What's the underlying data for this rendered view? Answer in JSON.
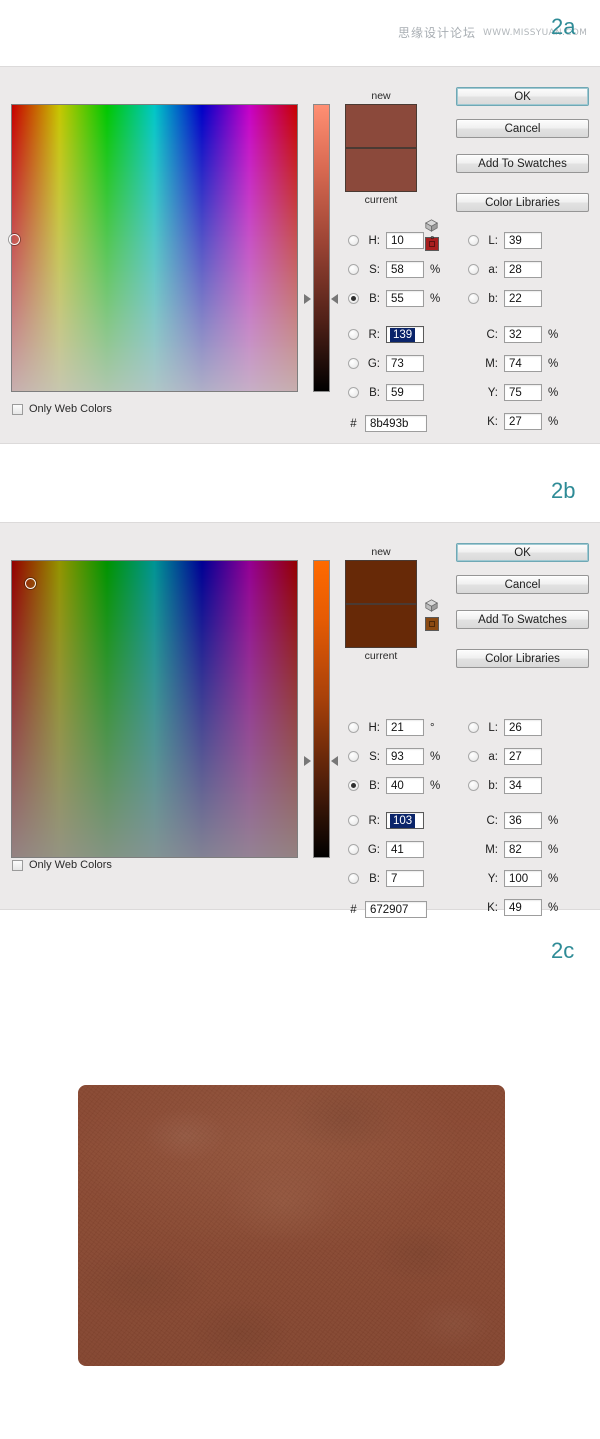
{
  "watermark": {
    "cn_text": "思缘设计论坛",
    "en_text": "WWW.MISSYUAN.COM"
  },
  "steps": [
    {
      "id": "2a",
      "label": "2a"
    },
    {
      "id": "2b",
      "label": "2b"
    },
    {
      "id": "2c",
      "label": "2c"
    }
  ],
  "accent_color": "#2e8b96",
  "dialogs": [
    {
      "id": "color-picker-2a",
      "picker": {
        "mode_axis": "brightness",
        "brightness_percent": 55,
        "marker_x_percent": 1,
        "marker_y_percent": 47,
        "slider_top_color": "#ff8f73",
        "slider_bottom_color": "#000000",
        "slider_handle_percent": 45
      },
      "only_web_colors": {
        "label": "Only Web Colors",
        "checked": false
      },
      "preview": {
        "new_label": "new",
        "current_label": "current",
        "new_color": "#8b493b",
        "current_color": "#8b493b",
        "gamut_icon": "out-of-gamut-warning-icon",
        "websafe_color": "#a81f1f"
      },
      "buttons": [
        {
          "name": "ok-button",
          "label": "OK",
          "primary": true
        },
        {
          "name": "cancel-button",
          "label": "Cancel",
          "primary": false
        },
        {
          "name": "add-to-swatches-button",
          "label": "Add To Swatches",
          "primary": false
        },
        {
          "name": "color-libraries-button",
          "label": "Color Libraries",
          "primary": false
        }
      ],
      "hsb": [
        {
          "key": "H",
          "label": "H:",
          "value": "10",
          "unit": "°",
          "selected_radio": false
        },
        {
          "key": "S",
          "label": "S:",
          "value": "58",
          "unit": "%",
          "selected_radio": false
        },
        {
          "key": "B",
          "label": "B:",
          "value": "55",
          "unit": "%",
          "selected_radio": true
        }
      ],
      "rgb": [
        {
          "key": "R",
          "label": "R:",
          "value": "139",
          "unit": "",
          "selected_radio": false,
          "text_selected": true
        },
        {
          "key": "G",
          "label": "G:",
          "value": "73",
          "unit": "",
          "selected_radio": false,
          "text_selected": false
        },
        {
          "key": "B",
          "label": "B:",
          "value": "59",
          "unit": "",
          "selected_radio": false,
          "text_selected": false
        }
      ],
      "hex": {
        "prefix": "#",
        "value": "8b493b"
      },
      "lab": [
        {
          "key": "L",
          "label": "L:",
          "value": "39",
          "unit": ""
        },
        {
          "key": "a",
          "label": "a:",
          "value": "28",
          "unit": ""
        },
        {
          "key": "b",
          "label": "b:",
          "value": "22",
          "unit": ""
        }
      ],
      "cmyk": [
        {
          "key": "C",
          "label": "C:",
          "value": "32",
          "unit": "%"
        },
        {
          "key": "M",
          "label": "M:",
          "value": "74",
          "unit": "%"
        },
        {
          "key": "Y",
          "label": "Y:",
          "value": "75",
          "unit": "%"
        },
        {
          "key": "K",
          "label": "K:",
          "value": "27",
          "unit": "%"
        }
      ]
    },
    {
      "id": "color-picker-2b",
      "picker": {
        "mode_axis": "brightness",
        "brightness_percent": 40,
        "marker_x_percent": 4,
        "marker_y_percent": 7,
        "slider_top_color": "#ff6a00",
        "slider_bottom_color": "#000000",
        "slider_handle_percent": 45,
        "field_brightness_overlay": 0.38
      },
      "only_web_colors": {
        "label": "Only Web Colors",
        "checked": false
      },
      "preview": {
        "new_label": "new",
        "current_label": "current",
        "new_color": "#672907",
        "current_color": "#672907",
        "gamut_icon": "out-of-gamut-warning-icon",
        "websafe_color": "#8a4a12"
      },
      "buttons": [
        {
          "name": "ok-button",
          "label": "OK",
          "primary": true
        },
        {
          "name": "cancel-button",
          "label": "Cancel",
          "primary": false
        },
        {
          "name": "add-to-swatches-button",
          "label": "Add To Swatches",
          "primary": false
        },
        {
          "name": "color-libraries-button",
          "label": "Color Libraries",
          "primary": false
        }
      ],
      "hsb": [
        {
          "key": "H",
          "label": "H:",
          "value": "21",
          "unit": "°",
          "selected_radio": false
        },
        {
          "key": "S",
          "label": "S:",
          "value": "93",
          "unit": "%",
          "selected_radio": false
        },
        {
          "key": "B",
          "label": "B:",
          "value": "40",
          "unit": "%",
          "selected_radio": true
        }
      ],
      "rgb": [
        {
          "key": "R",
          "label": "R:",
          "value": "103",
          "unit": "",
          "selected_radio": false,
          "text_selected": true
        },
        {
          "key": "G",
          "label": "G:",
          "value": "41",
          "unit": "",
          "selected_radio": false,
          "text_selected": false
        },
        {
          "key": "B",
          "label": "B:",
          "value": "7",
          "unit": "",
          "selected_radio": false,
          "text_selected": false
        }
      ],
      "hex": {
        "prefix": "#",
        "value": "672907"
      },
      "lab": [
        {
          "key": "L",
          "label": "L:",
          "value": "26",
          "unit": ""
        },
        {
          "key": "a",
          "label": "a:",
          "value": "27",
          "unit": ""
        },
        {
          "key": "b",
          "label": "b:",
          "value": "34",
          "unit": ""
        }
      ],
      "cmyk": [
        {
          "key": "C",
          "label": "C:",
          "value": "36",
          "unit": "%"
        },
        {
          "key": "M",
          "label": "M:",
          "value": "82",
          "unit": "%"
        },
        {
          "key": "Y",
          "label": "Y:",
          "value": "100",
          "unit": "%"
        },
        {
          "key": "K",
          "label": "K:",
          "value": "49",
          "unit": "%"
        }
      ]
    }
  ],
  "leather_swatch": {
    "name": "leather-texture-rectangle",
    "base_color": "#8b4a33",
    "edge_color": "#5c2e1c",
    "corner_radius": "8px"
  }
}
